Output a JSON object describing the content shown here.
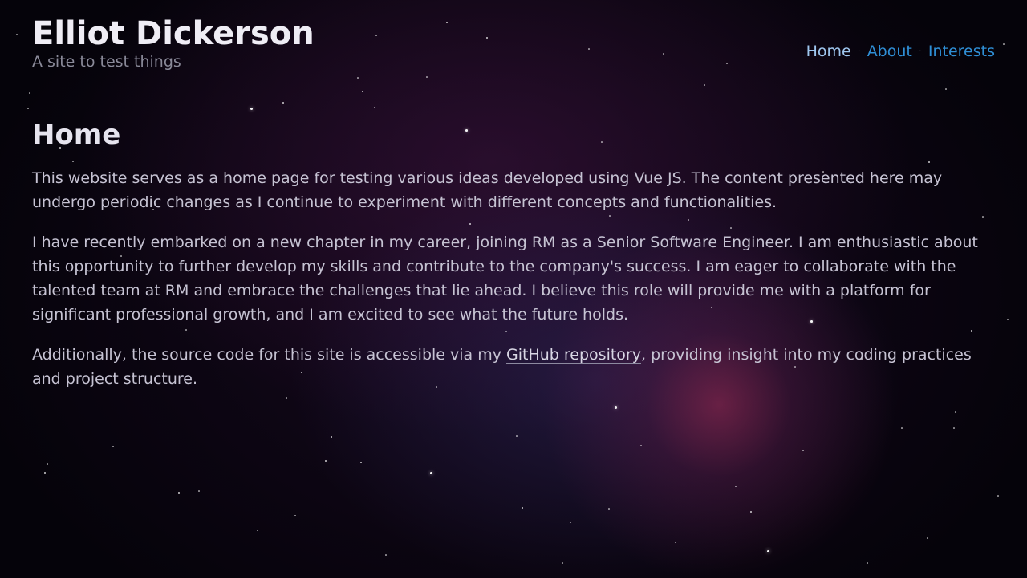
{
  "site": {
    "title": "Elliot Dickerson",
    "tagline": "A site to test things"
  },
  "nav": {
    "items": [
      {
        "label": "Home",
        "active": true
      },
      {
        "label": "About",
        "active": false
      },
      {
        "label": "Interests",
        "active": false
      }
    ],
    "separator": "·"
  },
  "main": {
    "title": "Home",
    "paragraphs": [
      "This website serves as a home page for testing various ideas developed using Vue JS. The content presented here may undergo periodic changes as I continue to experiment with different concepts and functionalities.",
      "I have recently embarked on a new chapter in my career, joining RM as a Senior Software Engineer. I am enthusiastic about this opportunity to further develop my skills and contribute to the company's success. I am eager to collaborate with the talented team at RM and embrace the challenges that lie ahead. I believe this role will provide me with a platform for significant professional growth, and I am excited to see what the future holds."
    ],
    "source": {
      "before": "Additionally, the source code for this site is accessible via my ",
      "link": "GitHub repository",
      "after": ", providing insight into my coding practices and project structure."
    }
  },
  "colors": {
    "link": "#2f8fd6",
    "link_active": "#9fc7ef",
    "title": "#efedf5",
    "text": "#c6c3d3",
    "tagline": "#8a8a99"
  }
}
